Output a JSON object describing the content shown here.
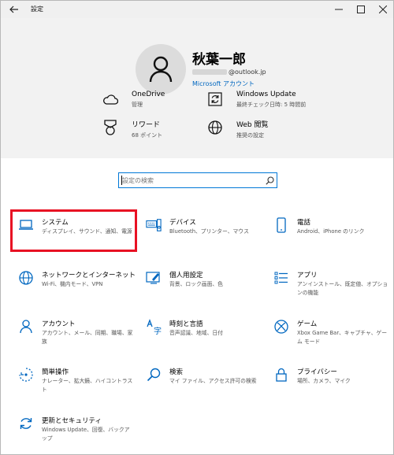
{
  "window": {
    "title": "設定"
  },
  "titlebar": {
    "back_icon": "arrow-left-icon",
    "min_icon": "minimize-icon",
    "max_icon": "maximize-icon",
    "close_icon": "close-icon"
  },
  "user": {
    "name": "秋葉一郎",
    "email_domain": "@outlook.jp",
    "account_link": "Microsoft アカウント"
  },
  "header_items": [
    {
      "id": "onedrive",
      "title": "OneDrive",
      "subtitle": "管理",
      "icon": "cloud-icon"
    },
    {
      "id": "windows-update",
      "title": "Windows Update",
      "subtitle": "最終チェック日時: 5 時間前",
      "icon": "refresh-icon"
    },
    {
      "id": "rewards",
      "title": "リワード",
      "subtitle": "68 ポイント",
      "icon": "medal-icon"
    },
    {
      "id": "web-browsing",
      "title": "Web 閲覧",
      "subtitle": "推奨の設定",
      "icon": "globe-icon"
    }
  ],
  "search": {
    "placeholder": "設定の検索"
  },
  "tiles": [
    {
      "id": "system",
      "title": "システム",
      "desc": "ディスプレイ、サウンド、通知、電源",
      "icon": "laptop-icon",
      "selected": true
    },
    {
      "id": "devices",
      "title": "デバイス",
      "desc": "Bluetooth、プリンター、マウス",
      "icon": "keyboard-speaker-icon"
    },
    {
      "id": "phone",
      "title": "電話",
      "desc": "Android、iPhone のリンク",
      "icon": "phone-icon"
    },
    {
      "id": "network",
      "title": "ネットワークとインターネット",
      "desc": "Wi-Fi、機内モード、VPN",
      "icon": "globe-icon"
    },
    {
      "id": "personalization",
      "title": "個人用設定",
      "desc": "背景、ロック画面、色",
      "icon": "paint-icon"
    },
    {
      "id": "apps",
      "title": "アプリ",
      "desc": "アンインストール、既定値、オプションの機能",
      "icon": "apps-list-icon"
    },
    {
      "id": "accounts",
      "title": "アカウント",
      "desc": "アカウント、メール、同期、職場、家族",
      "icon": "person-icon"
    },
    {
      "id": "time-language",
      "title": "時刻と言語",
      "desc": "音声認識、地域、日付",
      "icon": "language-icon"
    },
    {
      "id": "gaming",
      "title": "ゲーム",
      "desc": "Xbox Game Bar、キャプチャ、ゲーム モード",
      "icon": "xbox-icon"
    },
    {
      "id": "ease-of-access",
      "title": "簡単操作",
      "desc": "ナレーター、拡大鏡、ハイコントラスト",
      "icon": "ease-of-access-icon"
    },
    {
      "id": "search",
      "title": "検索",
      "desc": "マイ ファイル、アクセス許可の検索",
      "icon": "search-icon"
    },
    {
      "id": "privacy",
      "title": "プライバシー",
      "desc": "場所、カメラ、マイク",
      "icon": "lock-icon"
    },
    {
      "id": "update-security",
      "title": "更新とセキュリティ",
      "desc": "Windows Update、回復、バックアップ",
      "icon": "refresh-icon"
    }
  ],
  "colors": {
    "accent": "#0067c0",
    "selection": "#e81123",
    "header_bg": "#f2f2f2"
  }
}
